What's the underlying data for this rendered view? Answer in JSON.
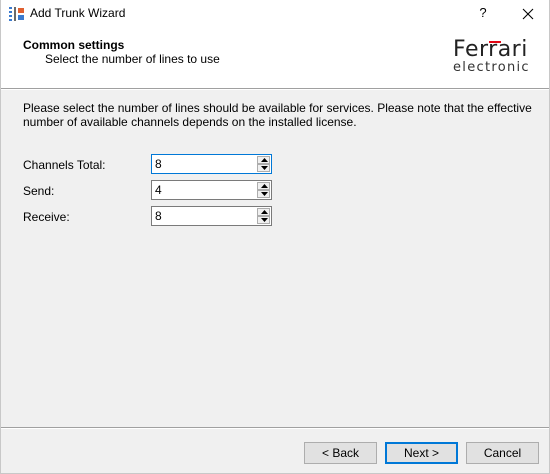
{
  "window": {
    "title": "Add Trunk Wizard",
    "help_label": "?"
  },
  "header": {
    "title": "Common settings",
    "subtitle": "Select the number of lines to use",
    "logo_top": "Ferrari",
    "logo_bottom": "electronic"
  },
  "body": {
    "instruction": "Please select the number of lines should be available for services. Please note that the effective number of available channels depends on the installed license."
  },
  "fields": {
    "channels_total": {
      "label": "Channels Total:",
      "value": "8"
    },
    "send": {
      "label": "Send:",
      "value": "4"
    },
    "receive": {
      "label": "Receive:",
      "value": "8"
    }
  },
  "buttons": {
    "back": "< Back",
    "next": "Next >",
    "cancel": "Cancel"
  },
  "colors": {
    "accent": "#0078d7",
    "window_bg": "#f0f0f0",
    "header_bg": "#ffffff",
    "logo_red": "#e30613"
  },
  "icons": {
    "app": "wizard-window-icon",
    "close": "close-icon",
    "spin_up": "arrow-up-icon",
    "spin_down": "arrow-down-icon"
  }
}
